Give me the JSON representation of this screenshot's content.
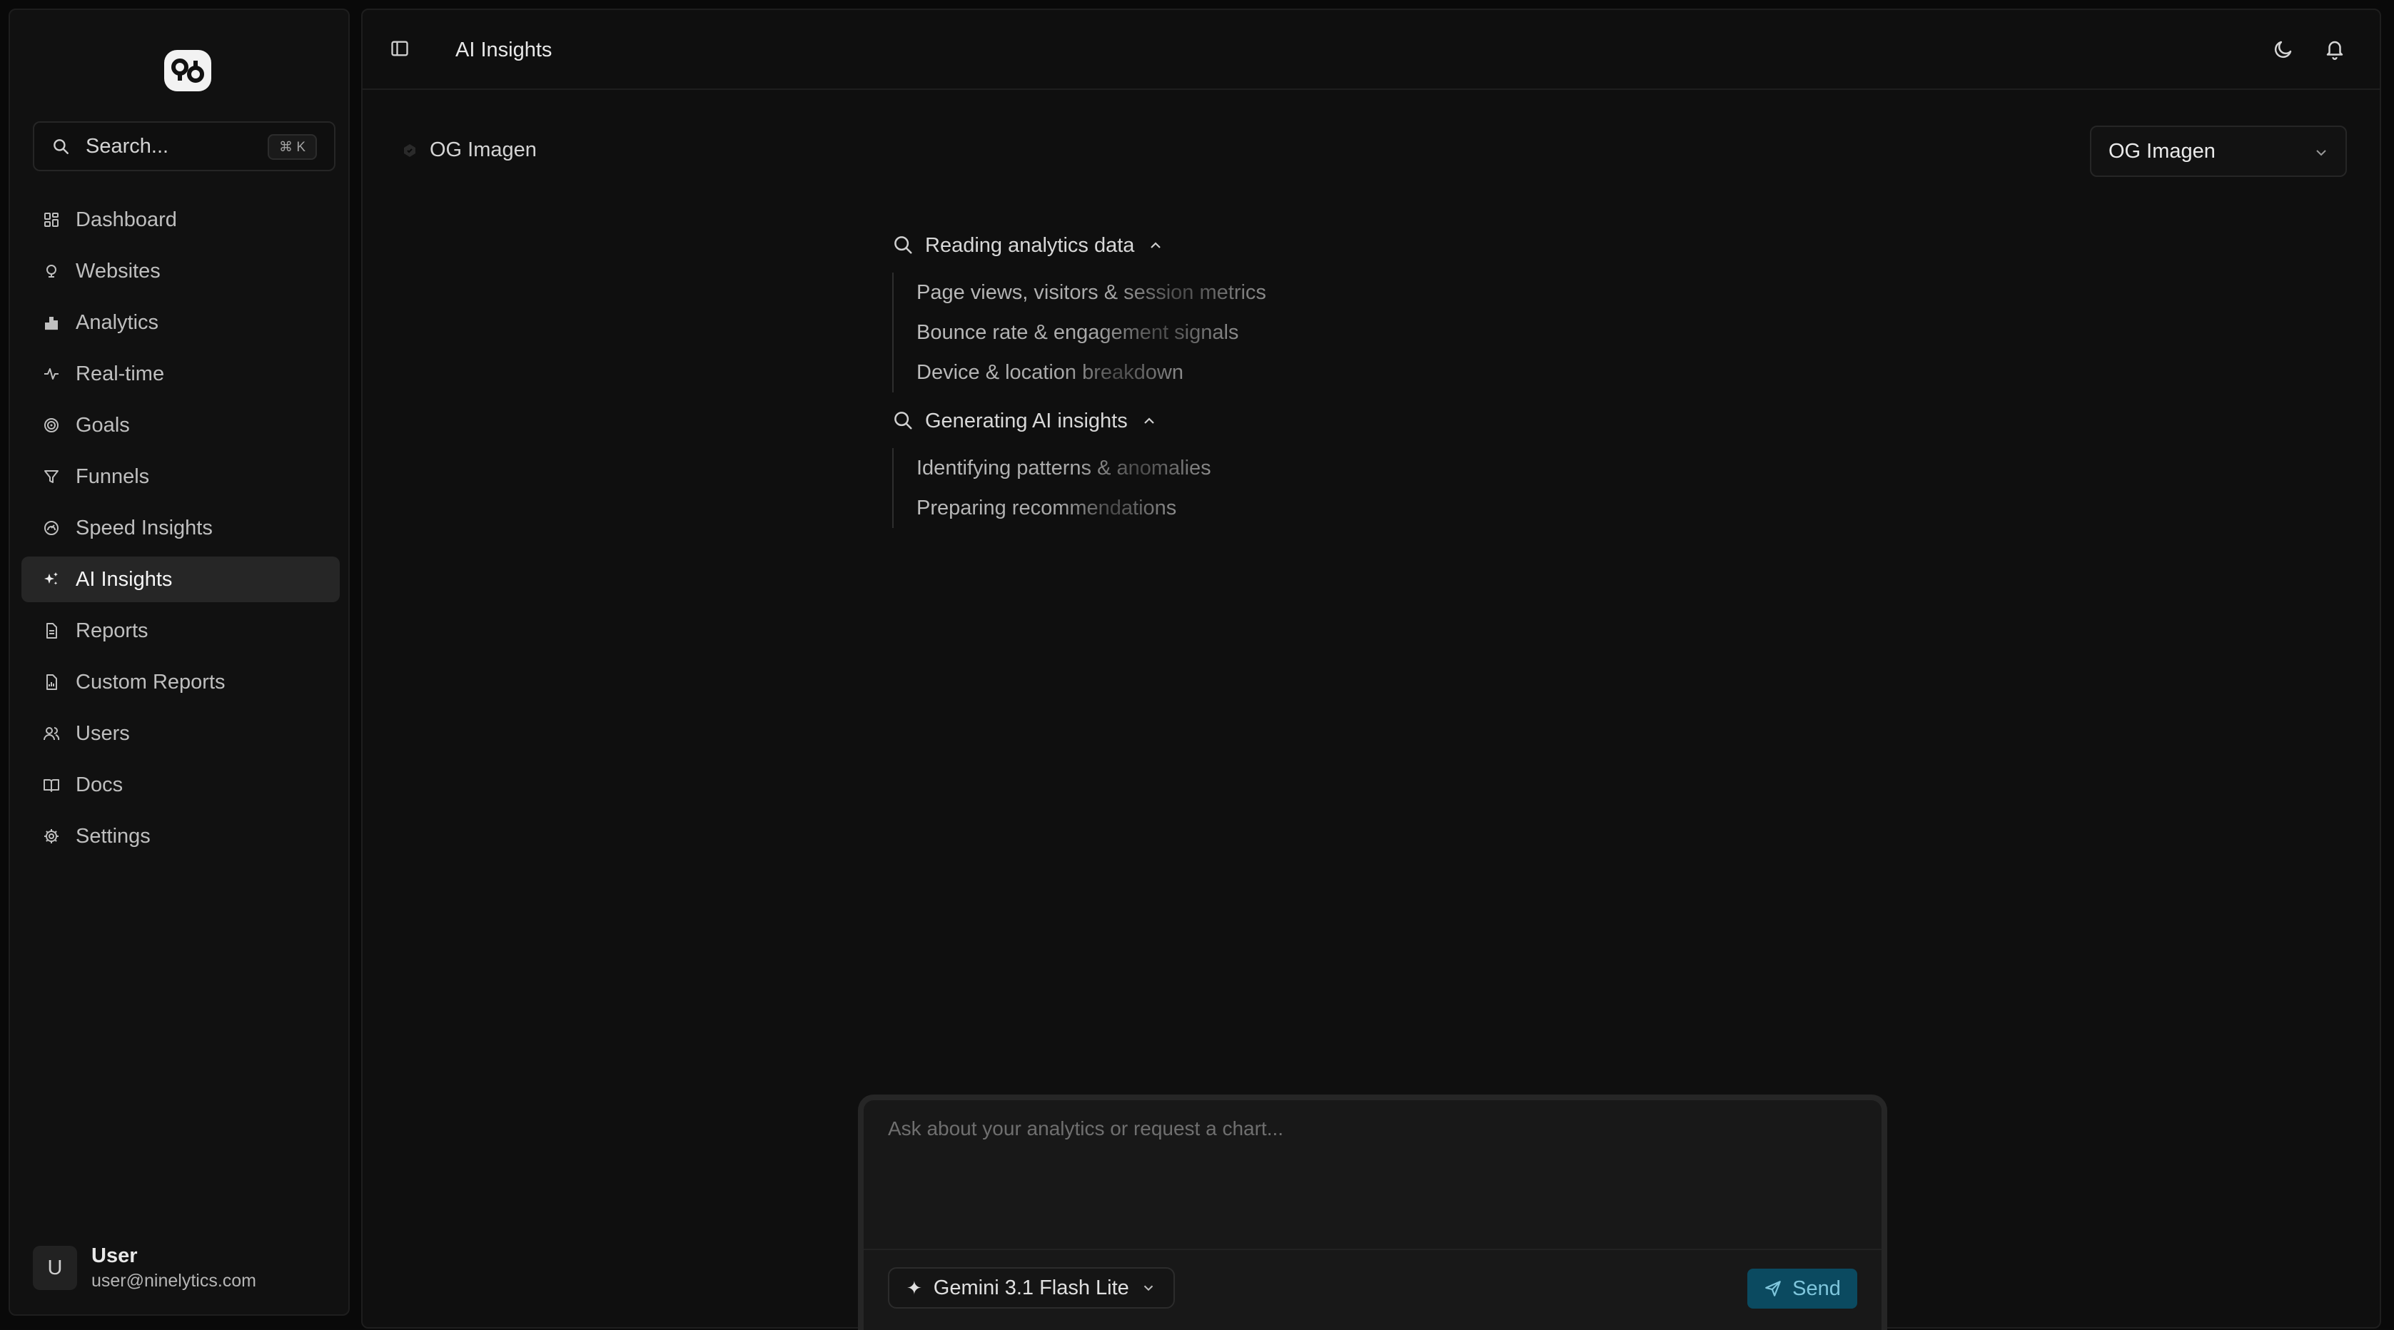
{
  "sidebar": {
    "search": {
      "label": "Search...",
      "shortcut": "⌘ K"
    },
    "items": [
      {
        "label": "Dashboard",
        "icon": "dashboard-icon"
      },
      {
        "label": "Websites",
        "icon": "globe-icon"
      },
      {
        "label": "Analytics",
        "icon": "bar-chart-icon"
      },
      {
        "label": "Real-time",
        "icon": "activity-icon"
      },
      {
        "label": "Goals",
        "icon": "target-icon"
      },
      {
        "label": "Funnels",
        "icon": "funnel-icon"
      },
      {
        "label": "Speed Insights",
        "icon": "gauge-icon"
      },
      {
        "label": "AI Insights",
        "icon": "sparkles-icon",
        "active": true
      },
      {
        "label": "Reports",
        "icon": "file-icon"
      },
      {
        "label": "Custom Reports",
        "icon": "file-chart-icon"
      },
      {
        "label": "Users",
        "icon": "users-icon"
      },
      {
        "label": "Docs",
        "icon": "book-icon"
      },
      {
        "label": "Settings",
        "icon": "gear-icon"
      }
    ],
    "user": {
      "initial": "U",
      "name": "User",
      "email": "user@ninelytics.com"
    }
  },
  "header": {
    "title": "AI Insights"
  },
  "site": {
    "label": "OG Imagen",
    "selected": "OG Imagen"
  },
  "steps": [
    {
      "title": "Reading analytics data",
      "items": [
        "Page views, visitors & session metrics",
        "Bounce rate & engagement signals",
        "Device & location breakdown"
      ]
    },
    {
      "title": "Generating AI insights",
      "items": [
        "Identifying patterns & anomalies",
        "Preparing recommendations"
      ]
    }
  ],
  "composer": {
    "placeholder": "Ask about your analytics or request a chart...",
    "model": "Gemini 3.1 Flash Lite",
    "send_label": "Send"
  },
  "colors": {
    "accent": "#0b4a60",
    "background": "#0f0f0f",
    "active_item": "#262626"
  }
}
